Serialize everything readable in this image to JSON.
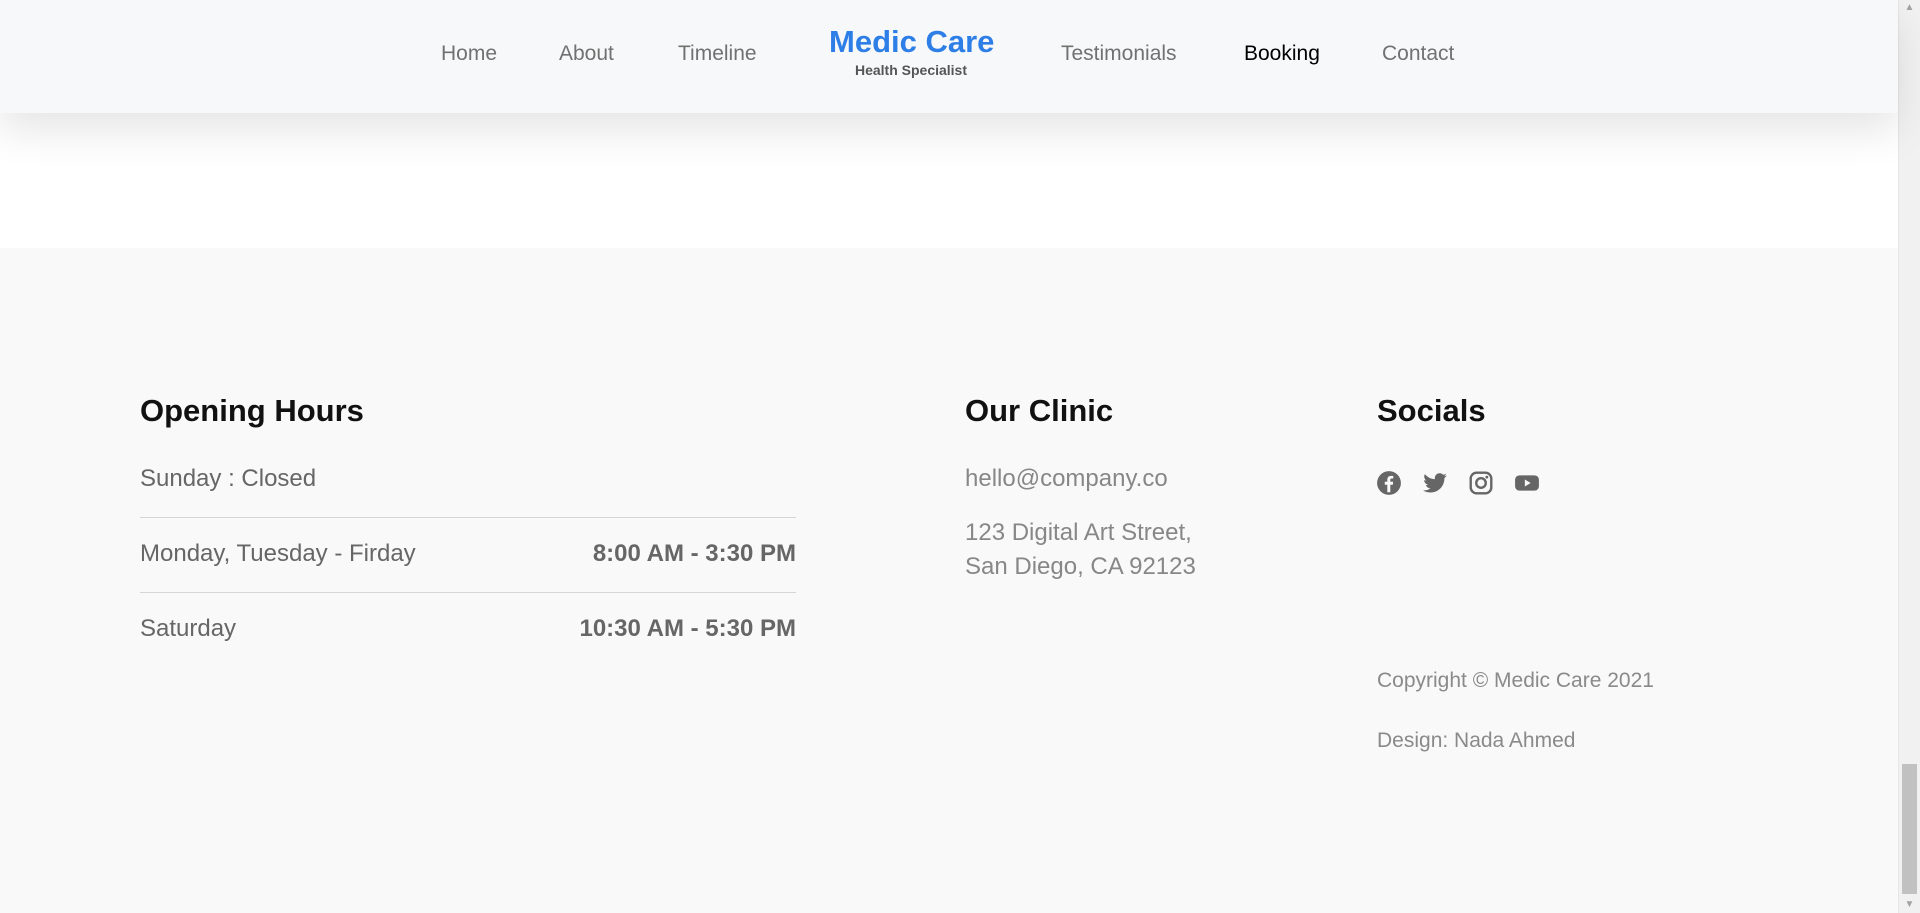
{
  "nav": {
    "links": [
      "Home",
      "About",
      "Timeline",
      "Testimonials",
      "Booking",
      "Contact"
    ],
    "active": "Booking",
    "brand_title": "Medic Care",
    "brand_subtitle": "Health Specialist",
    "brand_color": "#2d7ee6"
  },
  "footer": {
    "opening_hours": {
      "title": "Opening Hours",
      "rows": [
        {
          "day": "Sunday : Closed",
          "time": ""
        },
        {
          "day": "Monday, Tuesday - Firday",
          "time": "8:00 AM - 3:30 PM"
        },
        {
          "day": "Saturday",
          "time": "10:30 AM - 5:30 PM"
        }
      ]
    },
    "clinic": {
      "title": "Our Clinic",
      "email": "hello@company.co",
      "address_line1": "123 Digital Art Street,",
      "address_line2": "San Diego, CA 92123"
    },
    "socials": {
      "title": "Socials",
      "icons": [
        "facebook-icon",
        "twitter-icon",
        "instagram-icon",
        "youtube-icon"
      ]
    },
    "copyright": "Copyright © Medic Care 2021",
    "design": "Design: Nada Ahmed"
  },
  "colors": {
    "footer_bg": "#f9f9f9",
    "header_bg": "#f7f8f9"
  }
}
